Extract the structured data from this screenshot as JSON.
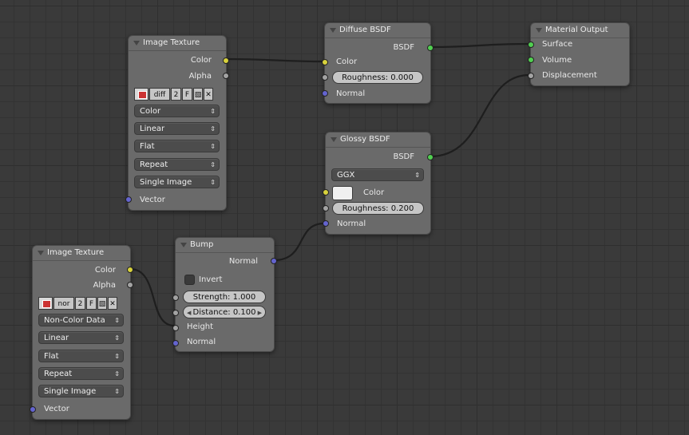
{
  "nodes": {
    "img1": {
      "title": "Image Texture",
      "out_color": "Color",
      "out_alpha": "Alpha",
      "image_name": "diff",
      "users": "2",
      "fake": "F",
      "color_space": "Color",
      "interpolation": "Linear",
      "projection": "Flat",
      "extension": "Repeat",
      "source": "Single Image",
      "in_vector": "Vector"
    },
    "diffuse": {
      "title": "Diffuse BSDF",
      "out_bsdf": "BSDF",
      "in_color": "Color",
      "roughness": "Roughness:  0.000",
      "in_normal": "Normal"
    },
    "output": {
      "title": "Material Output",
      "surface": "Surface",
      "volume": "Volume",
      "displacement": "Displacement"
    },
    "glossy": {
      "title": "Glossy BSDF",
      "out_bsdf": "BSDF",
      "distribution": "GGX",
      "in_color": "Color",
      "roughness": "Roughness:  0.200",
      "in_normal": "Normal"
    },
    "bump": {
      "title": "Bump",
      "out_normal": "Normal",
      "invert": "Invert",
      "strength": "Strength:  1.000",
      "distance": "Distance:  0.100",
      "in_height": "Height",
      "in_normal": "Normal"
    },
    "img2": {
      "title": "Image Texture",
      "out_color": "Color",
      "out_alpha": "Alpha",
      "image_name": "nor",
      "users": "2",
      "fake": "F",
      "color_space": "Non-Color Data",
      "interpolation": "Linear",
      "projection": "Flat",
      "extension": "Repeat",
      "source": "Single Image",
      "in_vector": "Vector"
    }
  },
  "colors": {
    "socket_color": "#d8d23c",
    "socket_float": "#a3a3a3",
    "socket_vector": "#6464cf",
    "socket_shader": "#51cf51",
    "node_bg": "#6a6a6a",
    "canvas_bg": "#3a3a3a"
  }
}
